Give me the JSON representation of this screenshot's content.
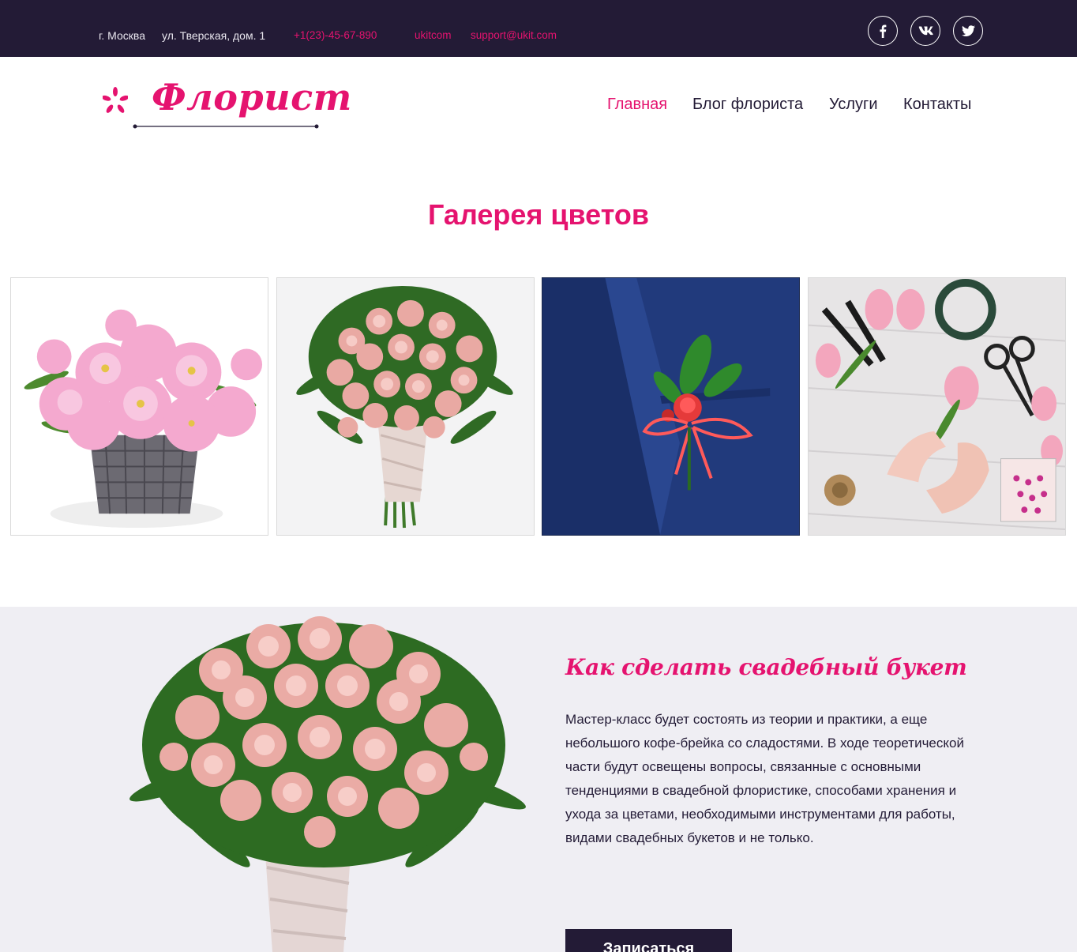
{
  "topbar": {
    "city": "г. Москва",
    "address": "ул. Тверская, дом. 1",
    "phone": "+1(23)-45-67-890",
    "site": "ukitcom",
    "email": "support@ukit.com",
    "social": [
      "facebook-icon",
      "vk-icon",
      "twitter-icon"
    ]
  },
  "header": {
    "logo": "Флорист",
    "nav": [
      "Главная",
      "Блог флориста",
      "Услуги",
      "Контакты"
    ],
    "active_nav": "Главная"
  },
  "gallery": {
    "title": "Галерея цветов",
    "images": [
      "pink-eustoma-basket",
      "pink-rose-bouquet",
      "red-boutonniere-on-suit",
      "florist-hands-with-tools"
    ]
  },
  "promo": {
    "title": "Как сделать свадебный букет",
    "text": "Мастер-класс будет состоять из теории и практики, а еще небольшого кофе-брейка со сладостями. В ходе теоретической части будут освещены вопросы, связанные с основными тенденциями в свадебной флористике, способами хранения и ухода за цветами, необходимыми инструментами для работы, видами свадебных букетов и не только.",
    "button": "Записаться",
    "image": "pink-rose-bouquet"
  },
  "colors": {
    "accent": "#e5136f",
    "dark": "#231b36",
    "promo_bg": "#efeef3"
  }
}
